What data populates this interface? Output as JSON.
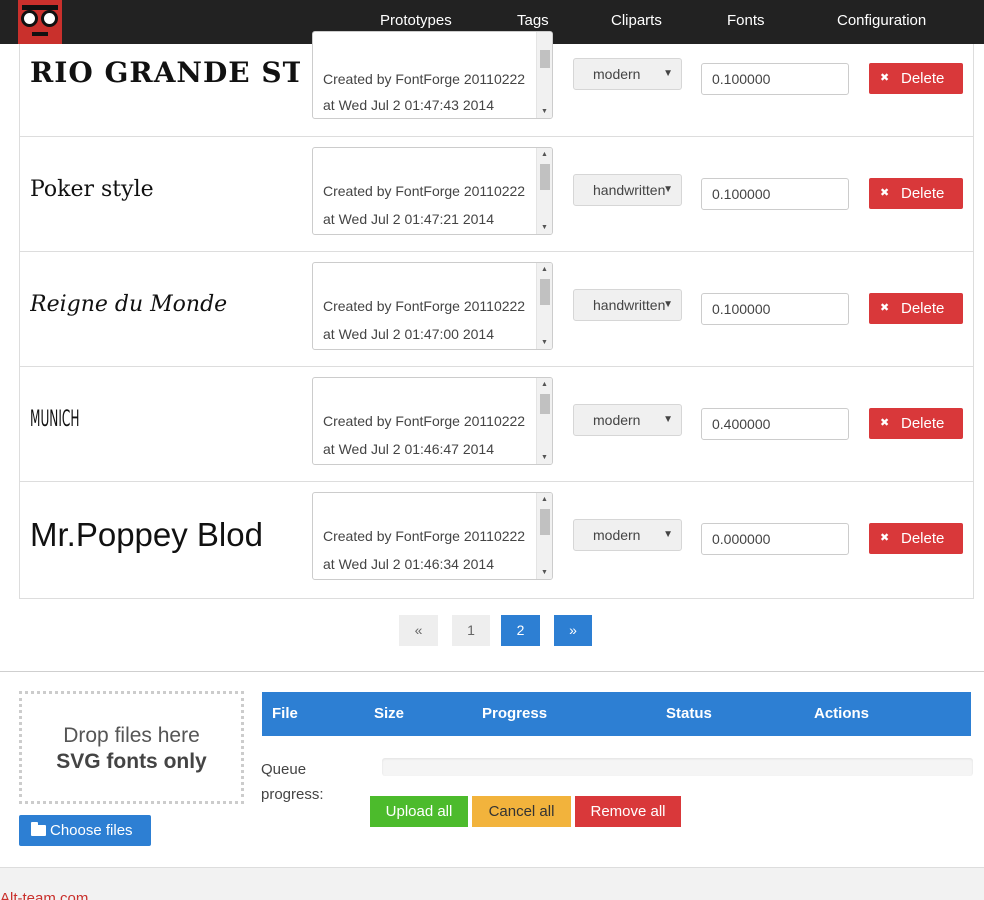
{
  "nav": {
    "logo": "app-logo",
    "items": [
      "Prototypes",
      "Tags",
      "Cliparts",
      "Fonts",
      "Configuration"
    ]
  },
  "fonts": [
    {
      "preview": "RIO GRANDE STRI",
      "desc_line1": "Created by FontForge 20110222",
      "desc_line2": "at Wed Jul  2 01:47:43 2014",
      "style": "modern",
      "weight": "0.100000",
      "delete_label": "Delete"
    },
    {
      "preview": "Poker style",
      "desc_line1": "Created by FontForge 20110222",
      "desc_line2": "at Wed Jul  2 01:47:21 2014",
      "style": "handwritten",
      "weight": "0.100000",
      "delete_label": "Delete"
    },
    {
      "preview": "Reigne du Monde",
      "desc_line1": "Created by FontForge 20110222",
      "desc_line2": "at Wed Jul  2 01:47:00 2014",
      "style": "handwritten",
      "weight": "0.100000",
      "delete_label": "Delete"
    },
    {
      "preview": "MUNICH",
      "desc_line1": "Created by FontForge 20110222",
      "desc_line2": "at Wed Jul  2 01:46:47 2014",
      "style": "modern",
      "weight": "0.400000",
      "delete_label": "Delete"
    },
    {
      "preview": "Mr.Poppey Blod",
      "desc_line1": "Created by FontForge 20110222",
      "desc_line2": "at Wed Jul  2 01:46:34 2014",
      "style": "modern",
      "weight": "0.000000",
      "delete_label": "Delete"
    }
  ],
  "pagination": {
    "prev": "«",
    "pages": [
      "1",
      "2"
    ],
    "current": "2",
    "next": "»"
  },
  "upload": {
    "drop_line1": "Drop files here",
    "drop_line2": "SVG fonts only",
    "choose_label": "Choose files",
    "columns": [
      "File",
      "Size",
      "Progress",
      "Status",
      "Actions"
    ],
    "queue_label": "Queue progress:",
    "queue_progress": 0,
    "upload_all": "Upload all",
    "cancel_all": "Cancel all",
    "remove_all": "Remove all"
  },
  "footer": {
    "link": "Alt-team.com"
  },
  "colors": {
    "navbar": "#222222",
    "brand_red": "#c9302c",
    "primary_blue": "#2d7fd3",
    "danger": "#d9383a",
    "success": "#4cbb2c",
    "warning": "#f2b33c"
  }
}
